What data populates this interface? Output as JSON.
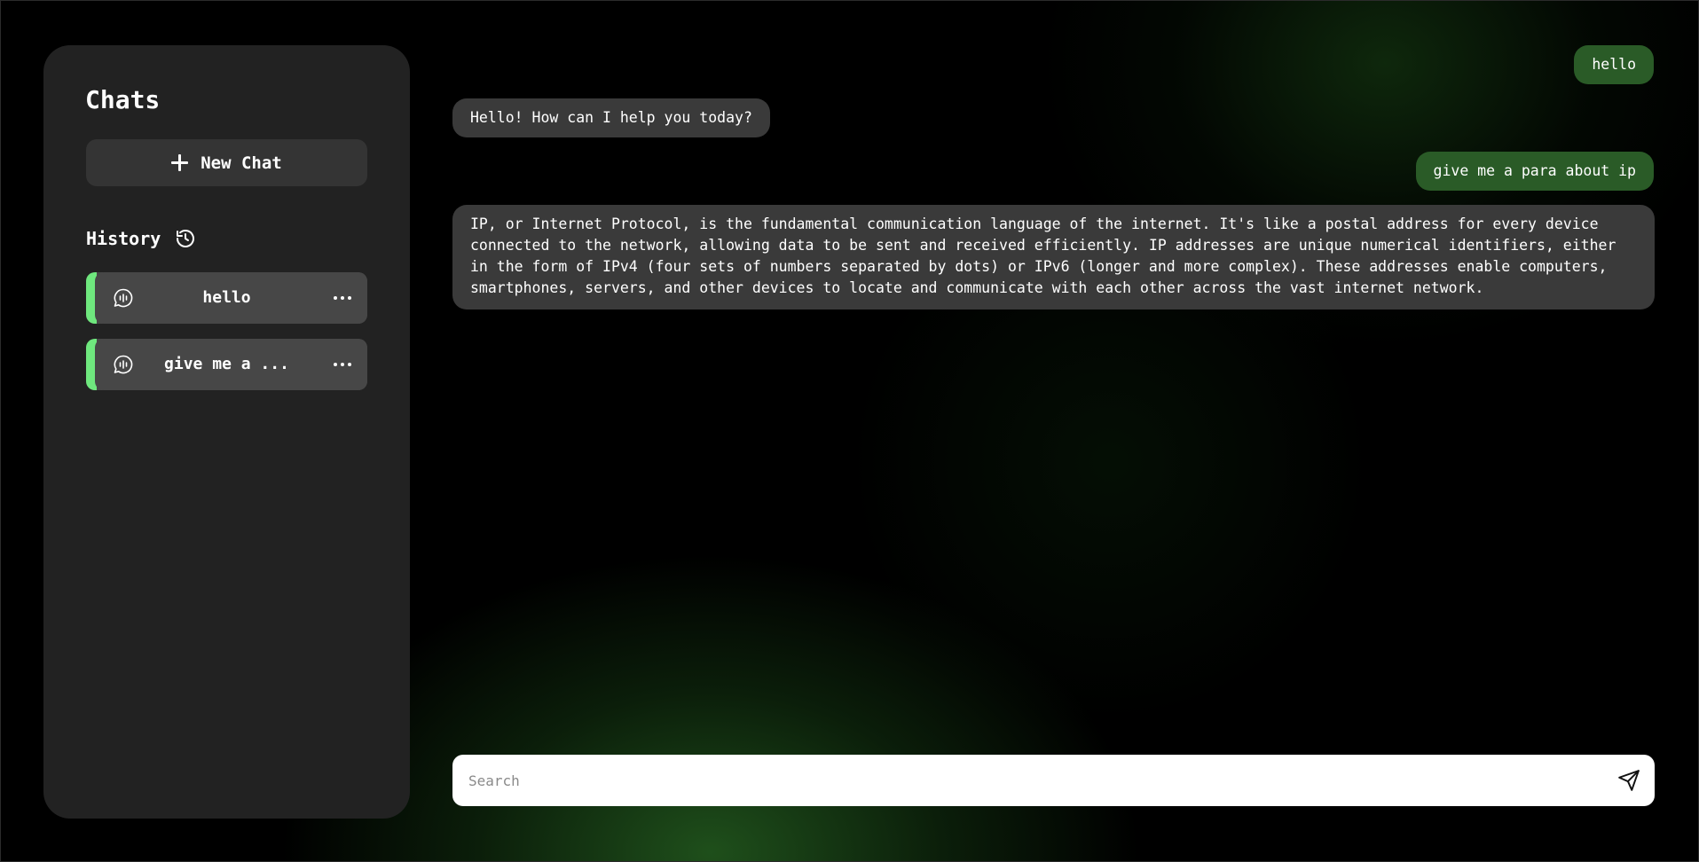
{
  "sidebar": {
    "title": "Chats",
    "new_chat_label": "New Chat",
    "history_label": "History",
    "items": [
      {
        "label": "hello",
        "icon": "chat-bubble-icon"
      },
      {
        "label": "give me a ...",
        "icon": "chat-bubble-icon"
      }
    ]
  },
  "messages": [
    {
      "role": "user",
      "text": "hello"
    },
    {
      "role": "assistant",
      "text": "Hello! How can I help you today?"
    },
    {
      "role": "user",
      "text": "give me a para about ip"
    },
    {
      "role": "assistant",
      "text": "IP, or Internet Protocol, is the fundamental communication language of the internet. It's like a postal address for every device connected to the network, allowing data to be sent and received efficiently. IP addresses are unique numerical identifiers, either in the form of IPv4 (four sets of numbers separated by dots) or IPv6 (longer and more complex). These addresses enable computers, smartphones, servers, and other devices to locate and communicate with each other across the vast internet network."
    }
  ],
  "input": {
    "placeholder": "Search",
    "value": ""
  },
  "colors": {
    "accent": "#6fe87e",
    "user_bubble": "#2a5b27",
    "assistant_bubble": "#3a3a3a",
    "sidebar_bg": "#222222",
    "chat_item_bg": "#474747"
  }
}
